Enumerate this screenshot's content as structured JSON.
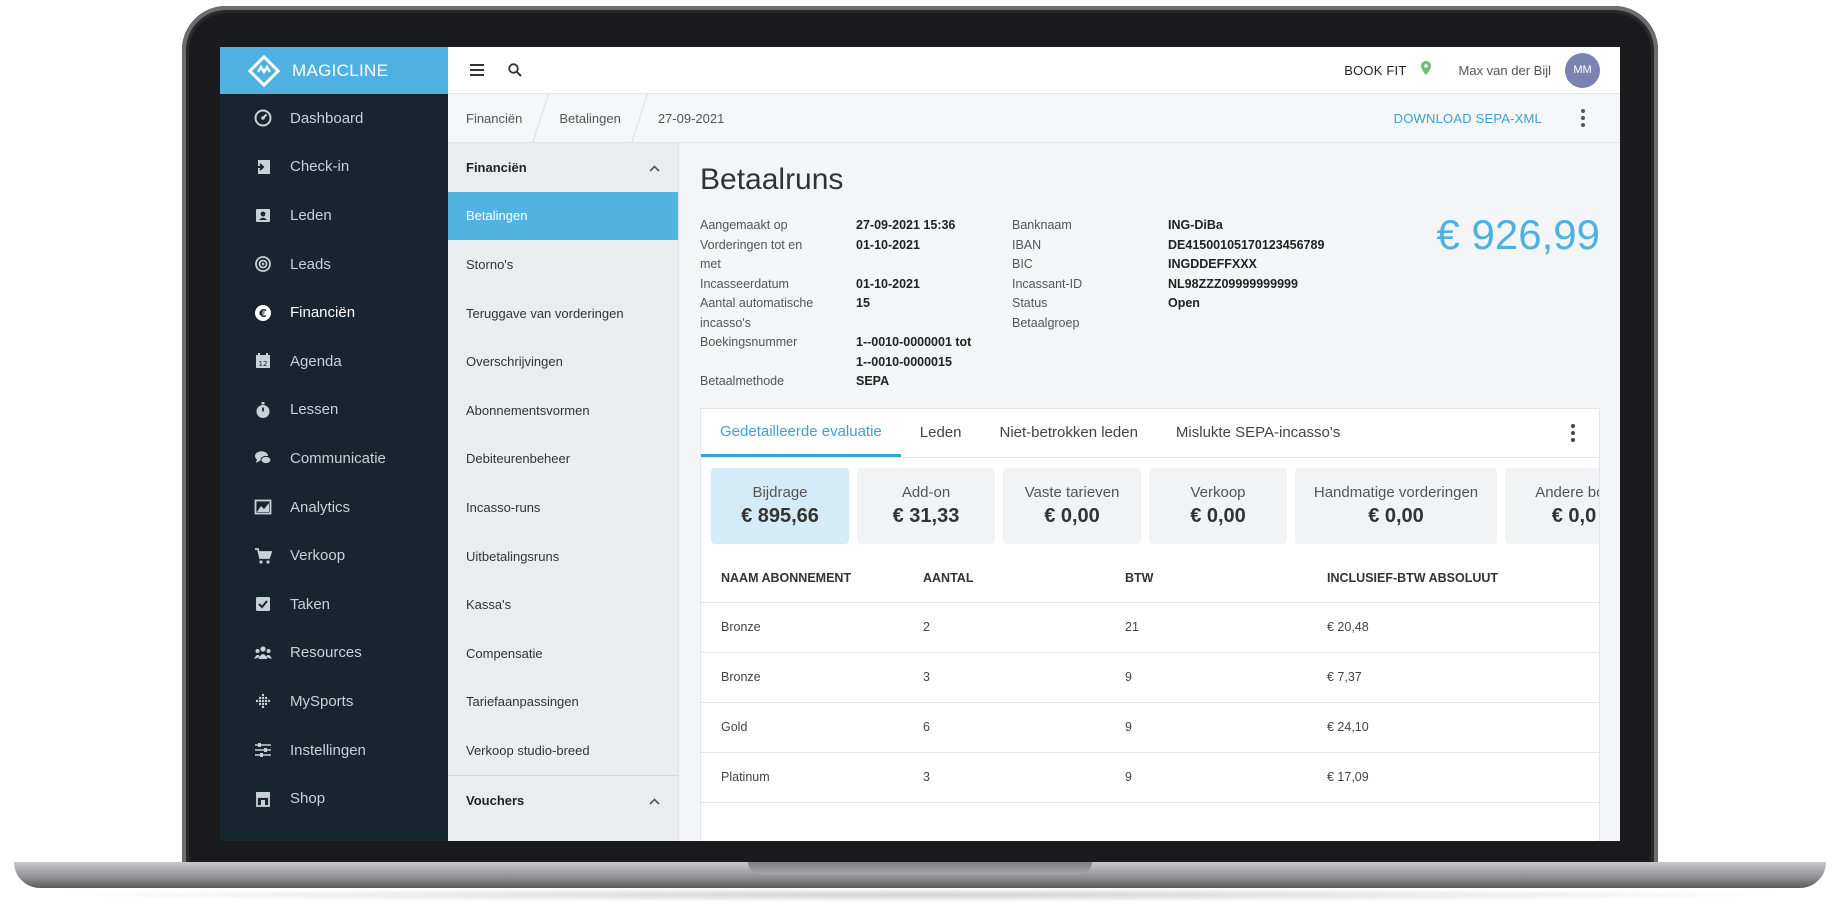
{
  "brand": {
    "name": "MAGICLINE"
  },
  "sidebar": {
    "items": [
      {
        "label": "Dashboard",
        "icon": "dashboard-icon"
      },
      {
        "label": "Check-in",
        "icon": "check-in-icon"
      },
      {
        "label": "Leden",
        "icon": "members-icon"
      },
      {
        "label": "Leads",
        "icon": "leads-icon"
      },
      {
        "label": "Financiën",
        "icon": "euro-icon"
      },
      {
        "label": "Agenda",
        "icon": "calendar-icon"
      },
      {
        "label": "Lessen",
        "icon": "stopwatch-icon"
      },
      {
        "label": "Communicatie",
        "icon": "chat-icon"
      },
      {
        "label": "Analytics",
        "icon": "chart-icon"
      },
      {
        "label": "Verkoop",
        "icon": "cart-icon"
      },
      {
        "label": "Taken",
        "icon": "checkbox-icon"
      },
      {
        "label": "Resources",
        "icon": "people-icon"
      },
      {
        "label": "MySports",
        "icon": "dots-grid-icon"
      },
      {
        "label": "Instellingen",
        "icon": "sliders-icon"
      },
      {
        "label": "Shop",
        "icon": "store-icon"
      }
    ]
  },
  "topbar": {
    "studio": "BOOK FIT",
    "user": "Max van der Bijl",
    "avatar_initials": "MM"
  },
  "breadcrumb": {
    "items": [
      "Financiën",
      "Betalingen",
      "27-09-2021"
    ],
    "action": "DOWNLOAD SEPA-XML"
  },
  "subnav": {
    "section1": "Financiën",
    "items": [
      "Betalingen",
      "Storno's",
      "Teruggave van vorderingen",
      "Overschrijvingen",
      "Abonnementsvormen",
      "Debiteurenbeheer",
      "Incasso-runs",
      "Uitbetalingsruns",
      "Kassa's",
      "Compensatie",
      "Tariefaanpassingen",
      "Verkoop studio-breed"
    ],
    "section2": "Vouchers"
  },
  "page": {
    "title": "Betaalruns",
    "amount": "€ 926,99",
    "meta_left": {
      "created_label": "Aangemaakt op",
      "created_value": "27-09-2021 15:36",
      "claims_label_1": "Vorderingen tot en",
      "claims_label_2": "met",
      "claims_value": "01-10-2021",
      "collection_label": "Incasseerdatum",
      "collection_value": "01-10-2021",
      "count_label_1": "Aantal automatische",
      "count_label_2": "incasso's",
      "count_value": "15",
      "booking_label": "Boekingsnummer",
      "booking_value_1": "1--0010-0000001 tot",
      "booking_value_2": "1--0010-0000015",
      "method_label": "Betaalmethode",
      "method_value": "SEPA"
    },
    "meta_right": {
      "bank_label": "Banknaam",
      "bank_value": "ING-DiBa",
      "iban_label": "IBAN",
      "iban_value": "DE41500105170123456789",
      "bic_label": "BIC",
      "bic_value": "INGDDEFFXXX",
      "creditor_label": "Incassant-ID",
      "creditor_value": "NL98ZZZ09999999999",
      "status_label": "Status",
      "status_value": "Open",
      "group_label": "Betaalgroep"
    }
  },
  "tabs": [
    "Gedetailleerde evaluatie",
    "Leden",
    "Niet-betrokken leden",
    "Mislukte SEPA-incasso's"
  ],
  "tiles": [
    {
      "label": "Bijdrage",
      "value": "€ 895,66"
    },
    {
      "label": "Add-on",
      "value": "€ 31,33"
    },
    {
      "label": "Vaste tarieven",
      "value": "€ 0,00"
    },
    {
      "label": "Verkoop",
      "value": "€ 0,00"
    },
    {
      "label": "Handmatige vorderingen",
      "value": "€ 0,00"
    },
    {
      "label": "Andere boe",
      "value": "€ 0,0"
    }
  ],
  "table": {
    "headers": [
      "NAAM ABONNEMENT",
      "AANTAL",
      "BTW",
      "INCLUSIEF-BTW ABSOLUUT"
    ],
    "rows": [
      [
        "Bronze",
        "2",
        "21",
        "€ 20,48"
      ],
      [
        "Bronze",
        "3",
        "9",
        "€ 7,37"
      ],
      [
        "Gold",
        "6",
        "9",
        "€ 24,10"
      ],
      [
        "Platinum",
        "3",
        "9",
        "€ 17,09"
      ]
    ]
  },
  "colors": {
    "accent": "#4fb1e2",
    "sidebar": "#17252e",
    "active_tile": "#d4ecf8"
  }
}
